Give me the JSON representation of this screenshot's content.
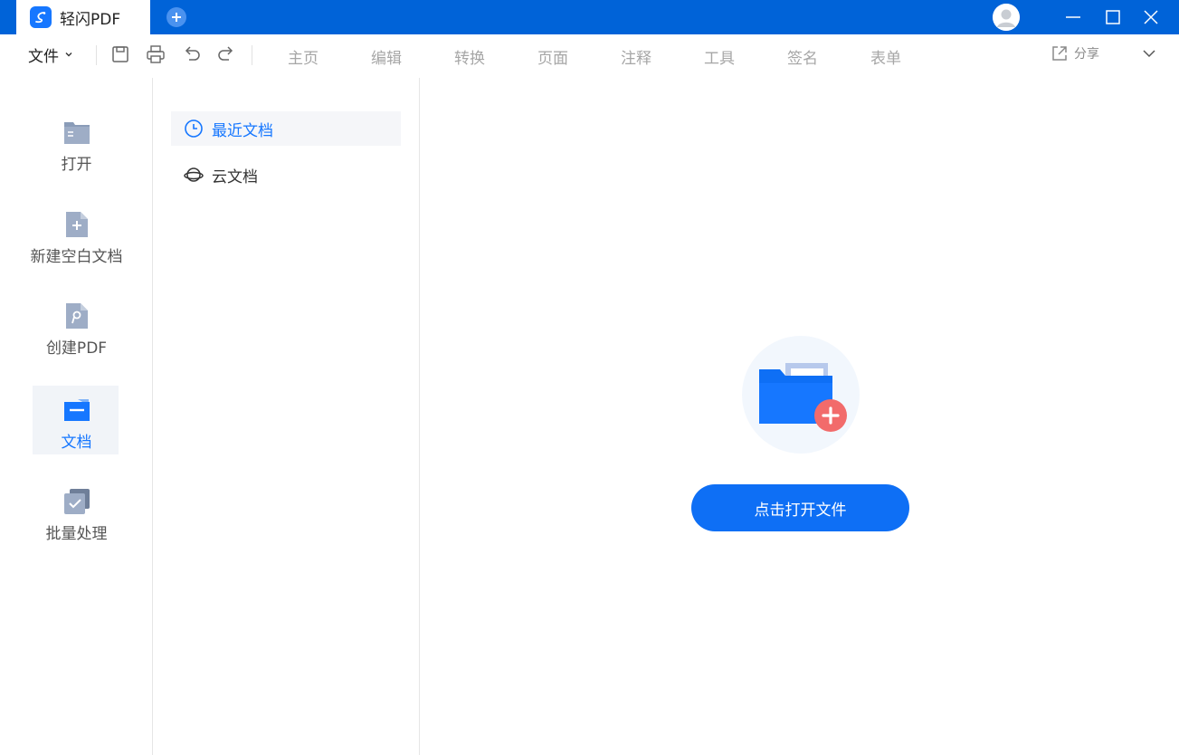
{
  "titlebar": {
    "tab_title": "轻闪PDF",
    "icons": [
      "app-logo-icon",
      "plus-icon",
      "user-avatar-icon",
      "minimize-icon",
      "maximize-icon",
      "close-icon"
    ]
  },
  "toolbar": {
    "file_menu_label": "文件",
    "menu_tabs": [
      "主页",
      "编辑",
      "转换",
      "页面",
      "注释",
      "工具",
      "签名",
      "表单"
    ],
    "share_label": "分享",
    "icons": [
      "save-icon",
      "print-icon",
      "undo-icon",
      "redo-icon",
      "share-icon",
      "chevron-down-icon"
    ]
  },
  "sidebar": {
    "items": [
      {
        "label": "打开",
        "icon": "folder-open-icon"
      },
      {
        "label": "新建空白文档",
        "icon": "new-document-icon"
      },
      {
        "label": "创建PDF",
        "icon": "create-pdf-icon"
      },
      {
        "label": "文档",
        "icon": "documents-icon",
        "active": true
      },
      {
        "label": "批量处理",
        "icon": "batch-process-icon"
      }
    ]
  },
  "midpanel": {
    "items": [
      {
        "label": "最近文档",
        "icon": "clock-icon",
        "active": true
      },
      {
        "label": "云文档",
        "icon": "cloud-planet-icon"
      }
    ]
  },
  "main": {
    "open_button_label": "点击打开文件",
    "illustration_icon": "folder-add-icon"
  },
  "colors": {
    "titlebar": "#0063d8",
    "accent": "#1677ff",
    "button": "#0e6ff5",
    "add_badge": "#f26b6b"
  }
}
